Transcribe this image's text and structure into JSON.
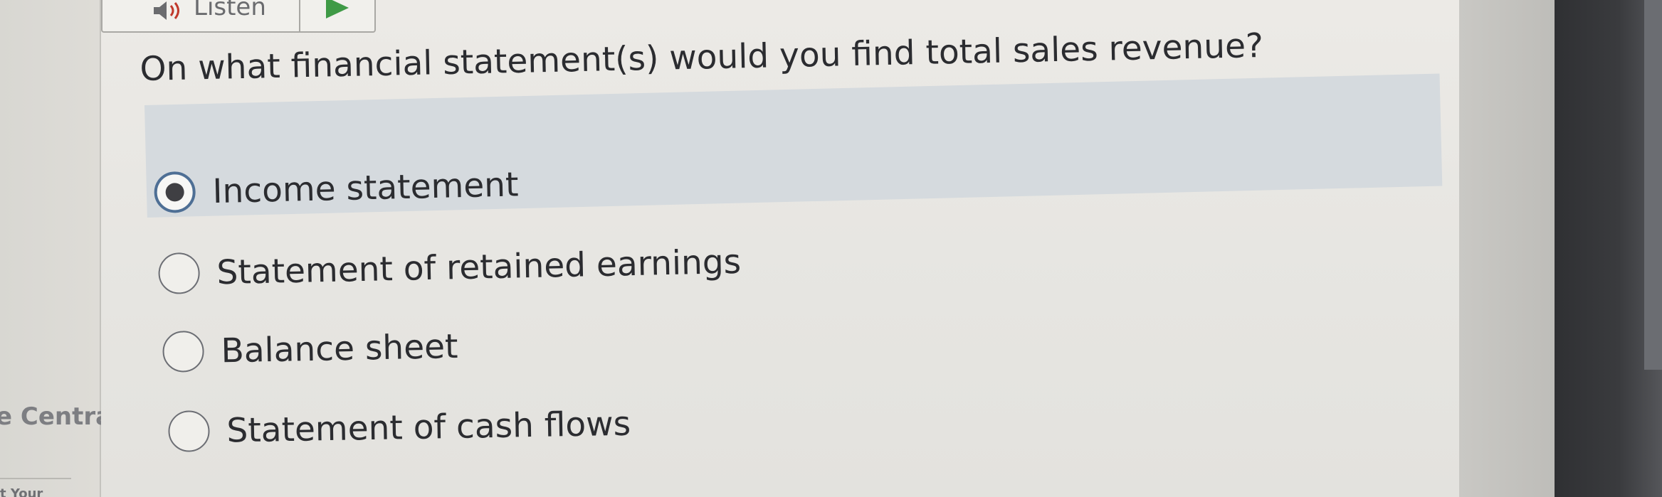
{
  "toolbar": {
    "listen_label": "Listen"
  },
  "sidebar": {
    "text": "e Centra",
    "cut_text": "t Your"
  },
  "question": {
    "text": "On what financial statement(s) would you find total sales revenue?"
  },
  "options": [
    {
      "label": "Income statement",
      "selected": true
    },
    {
      "label": "Statement of retained earnings",
      "selected": false
    },
    {
      "label": "Balance sheet",
      "selected": false
    },
    {
      "label": "Statement of cash flows",
      "selected": false
    }
  ],
  "icons": {
    "speaker": "speaker-icon",
    "play": "play-icon"
  },
  "colors": {
    "selected_highlight": "#d5dade",
    "radio_selected_ring": "#4e6f95",
    "play_green": "#3f9a46",
    "text": "#2b2c30"
  }
}
